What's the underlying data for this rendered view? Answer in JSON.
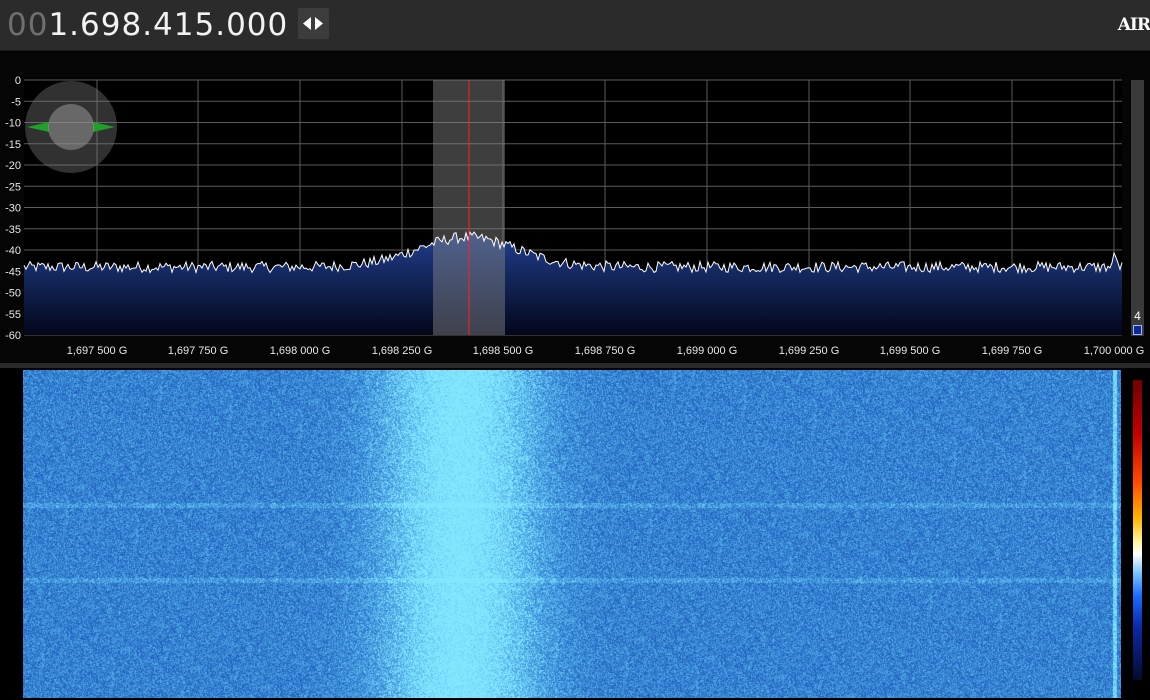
{
  "header": {
    "frequency_leading": "00",
    "frequency_value": "1.698.415.000",
    "brand": "AIR"
  },
  "spectrum": {
    "y_ticks": [
      "0",
      "-5",
      "-10",
      "-15",
      "-20",
      "-25",
      "-30",
      "-35",
      "-40",
      "-45",
      "-50",
      "-55",
      "-60"
    ],
    "y_range": [
      -60,
      0
    ],
    "x_ticks": [
      "1,697 500 G",
      "1,697 750 G",
      "1,698 000 G",
      "1,698 250 G",
      "1,698 500 G",
      "1,698 750 G",
      "1,699 000 G",
      "1,699 250 G",
      "1,699 500 G",
      "1,699 750 G",
      "1,700 000 G"
    ],
    "noise_floor_db": -44,
    "peak_db": -37
  },
  "side_slider": {
    "label": "4"
  },
  "colors": {
    "trace": "#ffffff",
    "fill_top": "#1f3f8e",
    "tuning_line": "#ff2020",
    "waterfall_base": "#0b3bb5"
  }
}
